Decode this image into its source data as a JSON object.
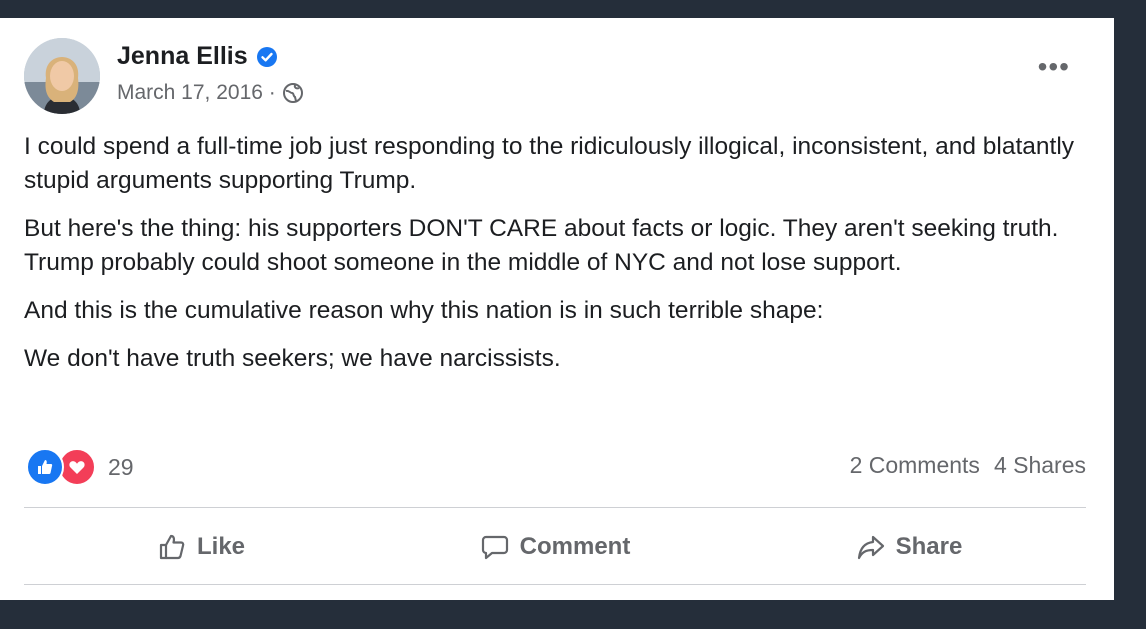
{
  "post": {
    "author": "Jenna Ellis",
    "date": "March 17, 2016 ·",
    "paragraphs": [
      "I could spend a full-time job just responding to the ridiculously illogical, inconsistent, and blatantly stupid arguments supporting Trump.",
      "But here's the thing: his supporters DON'T CARE about facts or logic. They aren't seeking truth. Trump probably could shoot someone in the middle of NYC and not lose support.",
      "And this is the cumulative reason why this nation is in such terrible shape:",
      "We don't have truth seekers; we have narcissists."
    ]
  },
  "reactions": {
    "count": "29",
    "comments": "2 Comments",
    "shares": "4 Shares"
  },
  "actions": {
    "like": "Like",
    "comment": "Comment",
    "share": "Share"
  },
  "icons": {
    "verified": "verified-badge-icon",
    "privacy": "globe-icon",
    "more": "more-options-icon",
    "like_reaction": "thumbs-up-icon",
    "love_reaction": "heart-icon"
  },
  "colors": {
    "background": "#252e3a",
    "accent": "#1877f2",
    "love": "#f33e58",
    "muted_text": "#65676b"
  }
}
